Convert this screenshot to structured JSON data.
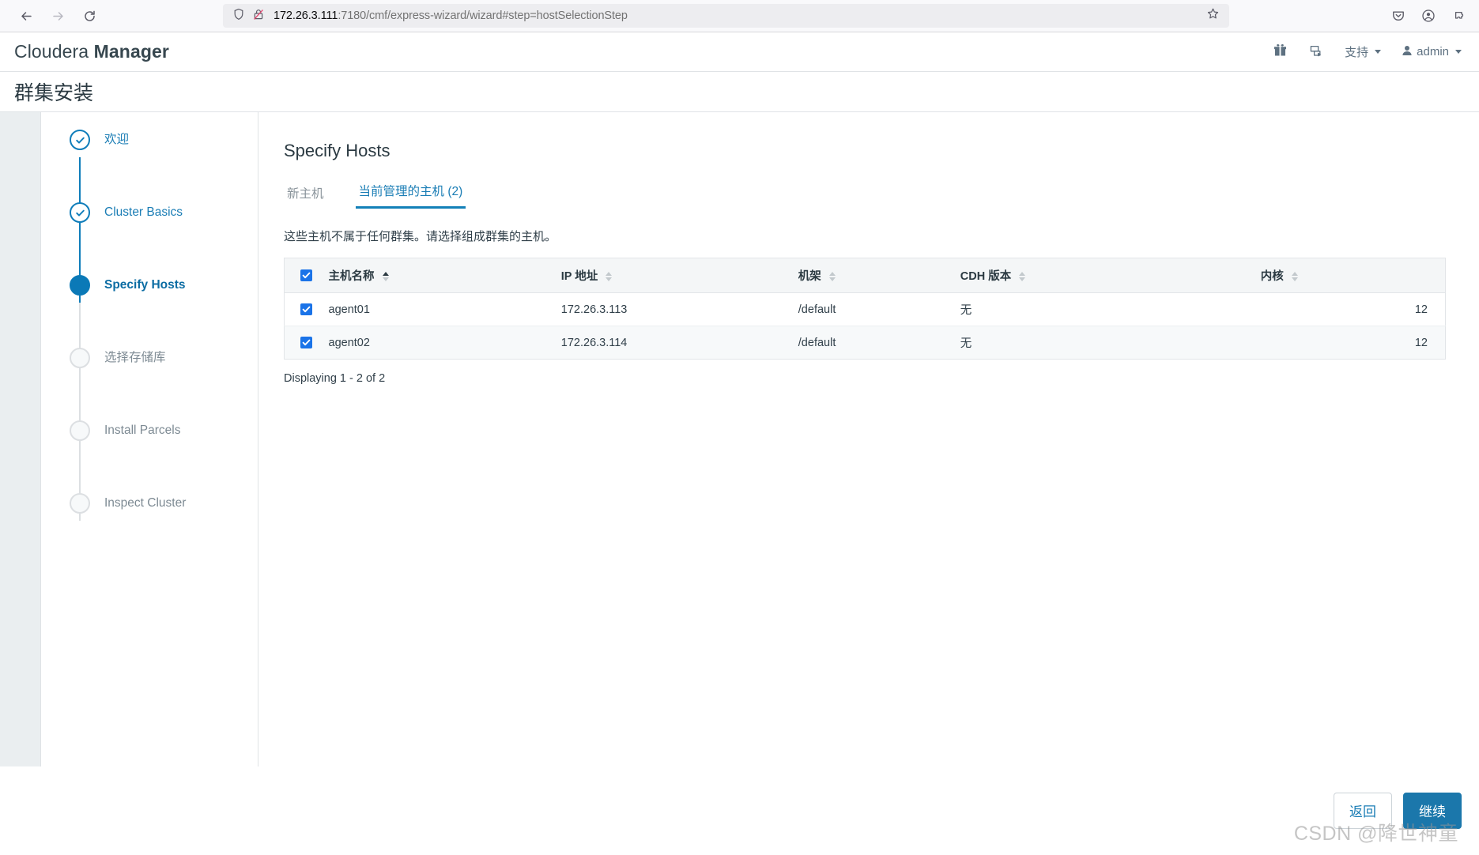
{
  "browser": {
    "back_icon": "arrow-left-icon",
    "forward_icon": "arrow-right-icon",
    "reload_icon": "reload-icon",
    "shield_icon": "shield-icon",
    "insecure_icon": "lock-crossed-icon",
    "url_host": "172.26.3.111",
    "url_rest": ":7180/cmf/express-wizard/wizard#step=hostSelectionStep",
    "url_full": "172.26.3.111:7180/cmf/express-wizard/wizard#step=hostSelectionStep",
    "bookmark_icon": "star-icon",
    "pocket_icon": "pocket-save-icon",
    "account_icon": "account-circle-icon",
    "extensions_icon": "puzzle-piece-icon"
  },
  "app_header": {
    "brand_light": "Cloudera ",
    "brand_bold": "Manager",
    "gift_icon": "gift-icon",
    "parcel_icon": "parcel-icon",
    "support_label": "支持",
    "user_label": "admin",
    "user_icon": "user-icon"
  },
  "page": {
    "title": "群集安装"
  },
  "steps": [
    {
      "label": "欢迎",
      "state": "done"
    },
    {
      "label": "Cluster Basics",
      "state": "done"
    },
    {
      "label": "Specify Hosts",
      "state": "active"
    },
    {
      "label": "选择存储库",
      "state": "todo"
    },
    {
      "label": "Install Parcels",
      "state": "todo"
    },
    {
      "label": "Inspect Cluster",
      "state": "todo"
    }
  ],
  "main": {
    "title": "Specify Hosts",
    "tabs": [
      {
        "label": "新主机",
        "active": false
      },
      {
        "label": "当前管理的主机 (2)",
        "active": true
      }
    ],
    "description": "这些主机不属于任何群集。请选择组成群集的主机。",
    "table": {
      "select_all_checked": true,
      "columns": [
        {
          "label": "主机名称",
          "sort": "asc"
        },
        {
          "label": "IP 地址",
          "sort": "none"
        },
        {
          "label": "机架",
          "sort": "none"
        },
        {
          "label": "CDH 版本",
          "sort": "none"
        },
        {
          "label": "内核",
          "sort": "none"
        }
      ],
      "rows": [
        {
          "checked": true,
          "hostname": "agent01",
          "ip": "172.26.3.113",
          "rack": "/default",
          "cdh": "无",
          "cores": "12"
        },
        {
          "checked": true,
          "hostname": "agent02",
          "ip": "172.26.3.114",
          "rack": "/default",
          "cdh": "无",
          "cores": "12"
        }
      ]
    },
    "displaying": "Displaying 1 - 2 of 2"
  },
  "footer": {
    "back_label": "返回",
    "continue_label": "继续",
    "watermark": "CSDN @降世神童"
  },
  "colors": {
    "accent": "#1b77ab",
    "link": "#1a7db5",
    "checkbox": "#1a73e8",
    "title": "#2b3a42"
  }
}
